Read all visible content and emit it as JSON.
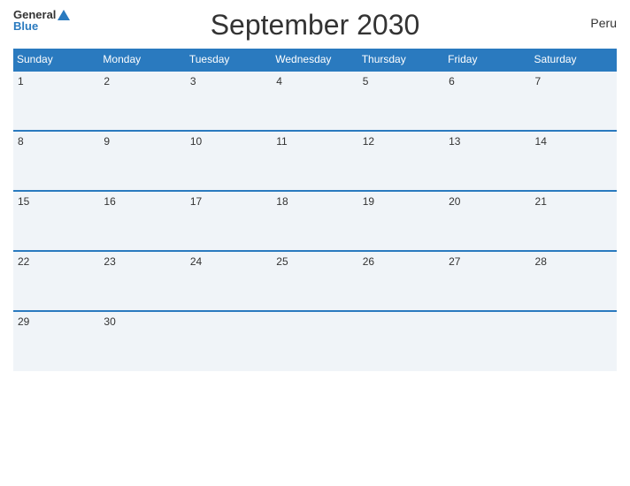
{
  "header": {
    "title": "September 2030",
    "country": "Peru",
    "logo_general": "General",
    "logo_blue": "Blue"
  },
  "weekdays": [
    "Sunday",
    "Monday",
    "Tuesday",
    "Wednesday",
    "Thursday",
    "Friday",
    "Saturday"
  ],
  "weeks": [
    [
      1,
      2,
      3,
      4,
      5,
      6,
      7
    ],
    [
      8,
      9,
      10,
      11,
      12,
      13,
      14
    ],
    [
      15,
      16,
      17,
      18,
      19,
      20,
      21
    ],
    [
      22,
      23,
      24,
      25,
      26,
      27,
      28
    ],
    [
      29,
      30,
      null,
      null,
      null,
      null,
      null
    ]
  ],
  "colors": {
    "header_bg": "#2a7abf",
    "cell_bg": "#f0f4f8",
    "border": "#2a7abf",
    "text": "#333333",
    "white": "#ffffff"
  }
}
